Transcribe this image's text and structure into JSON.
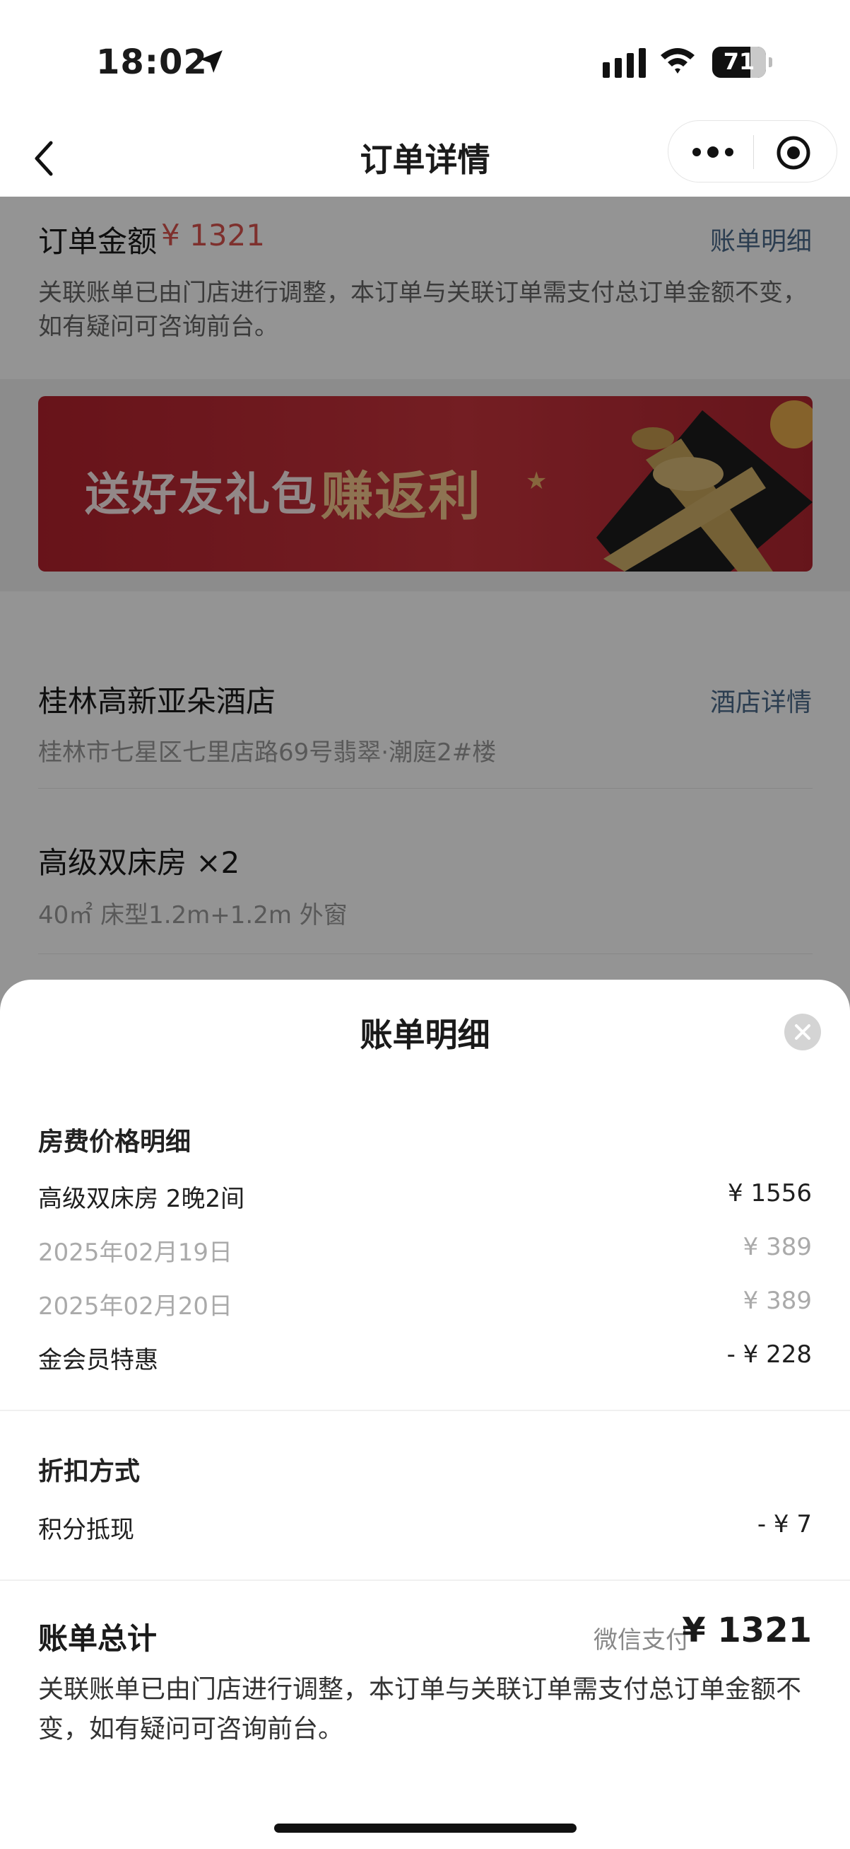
{
  "status": {
    "time": "18:02",
    "battery": "71"
  },
  "nav": {
    "title": "订单详情"
  },
  "order": {
    "amount_label": "订单金额",
    "amount_value": "¥ 1321",
    "bill_link": "账单明细",
    "note": "关联账单已由门店进行调整，本订单与关联订单需支付总订单金额不变，如有疑问可咨询前台。"
  },
  "banner": {
    "text1": "送好友礼包",
    "text2": "赚返利"
  },
  "hotel": {
    "name": "桂林高新亚朵酒店",
    "link": "酒店详情",
    "address": "桂林市七星区七里店路69号翡翠·潮庭2#楼"
  },
  "room": {
    "name": "高级双床房 ×2",
    "info": "40㎡ 床型1.2m+1.2m 外窗"
  },
  "sheet": {
    "title": "账单明细",
    "room_section": "房费价格明细",
    "room_line_label": "高级双床房  2晚2间",
    "room_line_value": "¥ 1556",
    "day1_label": "2025年02月19日",
    "day1_value": "¥ 389",
    "day2_label": "2025年02月20日",
    "day2_value": "¥ 389",
    "member_label": "金会员特惠",
    "member_value": "- ¥ 228",
    "discount_section": "折扣方式",
    "points_label": "积分抵现",
    "points_value": "- ¥ 7",
    "total_label": "账单总计",
    "pay_method": "微信支付",
    "total_value": "¥ 1321",
    "total_note": "关联账单已由门店进行调整，本订单与关联订单需支付总订单金额不变，如有疑问可咨询前台。"
  },
  "colors": {
    "price_red": "#d9534f",
    "link_blue": "#4a6a8a",
    "banner_red": "#c8343d"
  },
  "icons": [
    "location-arrow-icon",
    "signal-icon",
    "wifi-icon",
    "battery-icon",
    "back-chevron-icon",
    "more-dots-icon",
    "target-icon",
    "close-icon"
  ]
}
